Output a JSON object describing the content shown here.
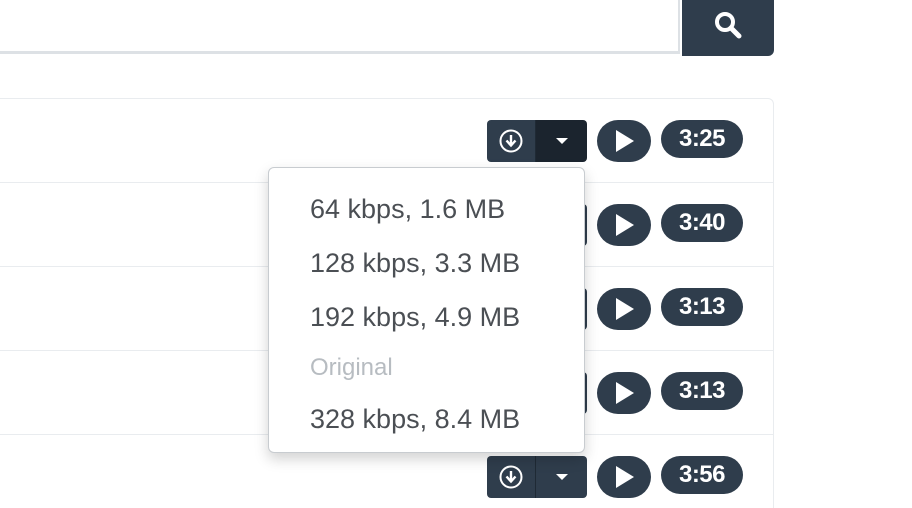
{
  "search": {
    "placeholder": "",
    "value": "",
    "button_icon": "search-icon"
  },
  "tracks": [
    {
      "duration": "3:25"
    },
    {
      "duration": "3:40"
    },
    {
      "duration": "3:13"
    },
    {
      "duration": "3:13"
    },
    {
      "duration": "3:56"
    }
  ],
  "download_menu": {
    "items": [
      "64 kbps, 1.6 MB",
      "128 kbps, 3.3 MB",
      "192 kbps, 4.9 MB"
    ],
    "header": "Original",
    "original_item": "328 kbps, 8.4 MB"
  },
  "colors": {
    "button_bg": "#2f3d4c",
    "button_active": "#1b242e",
    "menu_text": "#4b4f54",
    "menu_header": "#b7bcc1"
  }
}
